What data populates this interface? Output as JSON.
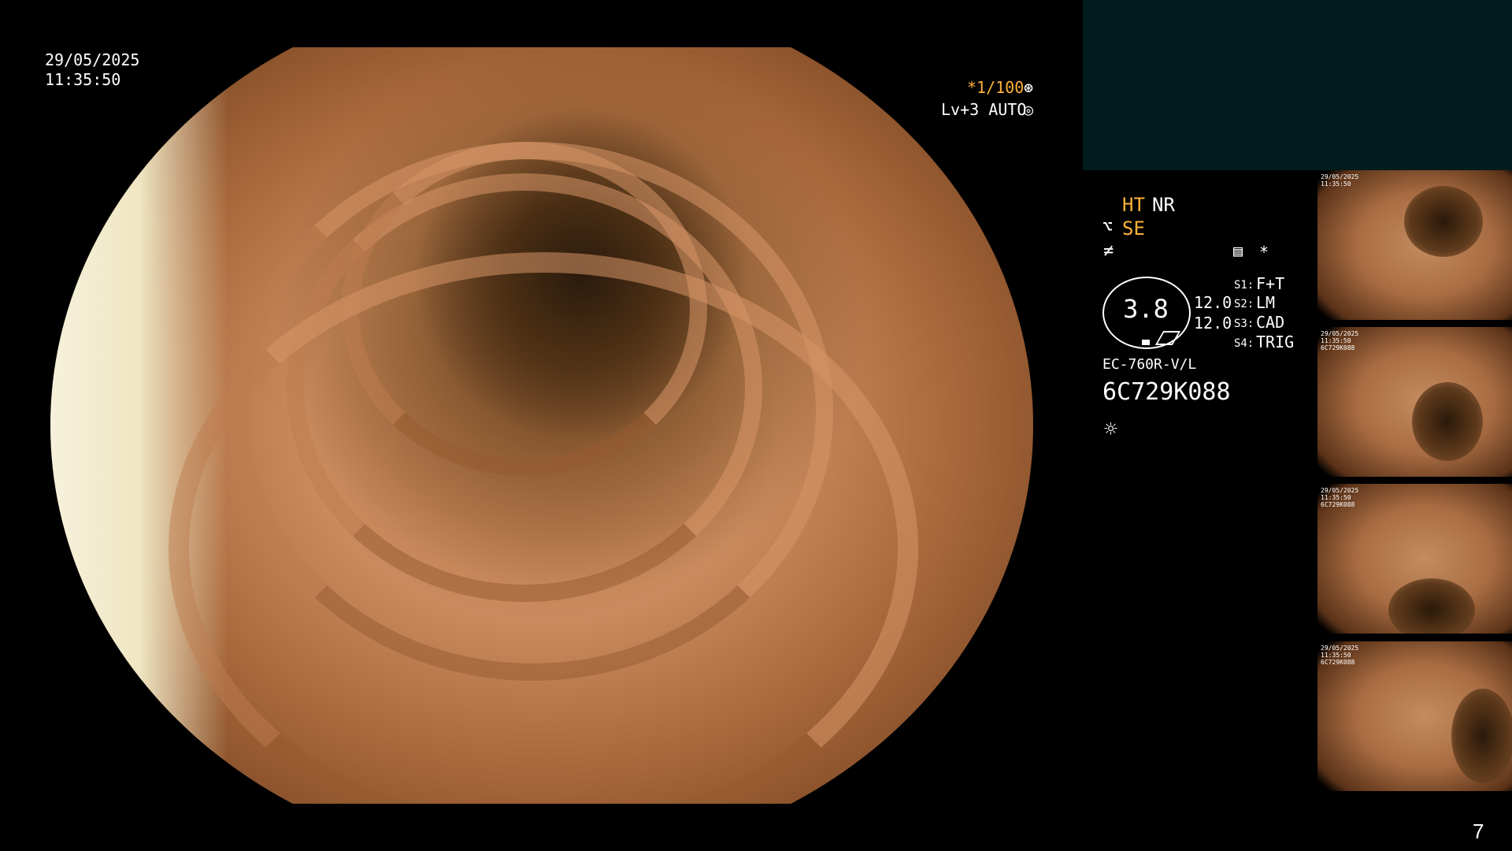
{
  "datetime": {
    "date": "29/05/2025",
    "time": "11:35:50"
  },
  "main_overlay": {
    "shutter": "*1/100",
    "shutter_icon": "aperture-icon",
    "level": "Lv+3 AUTO",
    "level_icon": "iris-icon"
  },
  "side_panel": {
    "mode_ht": "HT",
    "mode_nr": "NR",
    "mode_se": "SE",
    "magnification": "3.8",
    "value_1": "12.0",
    "value_2": "12.0",
    "switches": [
      {
        "key": "S1:",
        "value": "F+T"
      },
      {
        "key": "S2:",
        "value": "LM"
      },
      {
        "key": "S3:",
        "value": "CAD"
      },
      {
        "key": "S4:",
        "value": "TRIG"
      }
    ],
    "scope_model": "EC-760R-V/L",
    "serial": "6C729K088",
    "asterisk": "*",
    "colors": {
      "accent": "#ffb23a",
      "panel": "#001c1c"
    }
  },
  "thumbnails": [
    {
      "label": "29/05/2025\n11:35:50"
    },
    {
      "label": "29/05/2025\n11:35:50\n6C729K088"
    },
    {
      "label": "29/05/2025\n11:35:50\n6C729K088"
    },
    {
      "label": "29/05/2025\n11:35:50\n6C729K088"
    }
  ],
  "page_number": "7"
}
